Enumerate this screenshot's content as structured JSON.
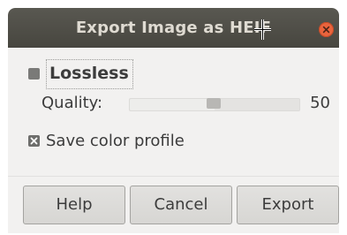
{
  "window": {
    "title": "Export Image as HEIF"
  },
  "options": {
    "lossless_label": "Lossless",
    "lossless_checked": false,
    "quality_label": "Quality:",
    "quality_value": "50",
    "quality_fraction": 0.5,
    "save_color_profile_label": "Save color profile",
    "save_color_profile_checked": true
  },
  "buttons": {
    "help": "Help",
    "cancel": "Cancel",
    "export": "Export"
  },
  "icons": {
    "close": "close-icon",
    "cursor": "crosshair-cursor-icon",
    "checkmark": "x-check-icon"
  },
  "colors": {
    "titlebar": "#4f4e47",
    "close_button": "#e9643d",
    "dialog_background": "#f2f1f0"
  }
}
